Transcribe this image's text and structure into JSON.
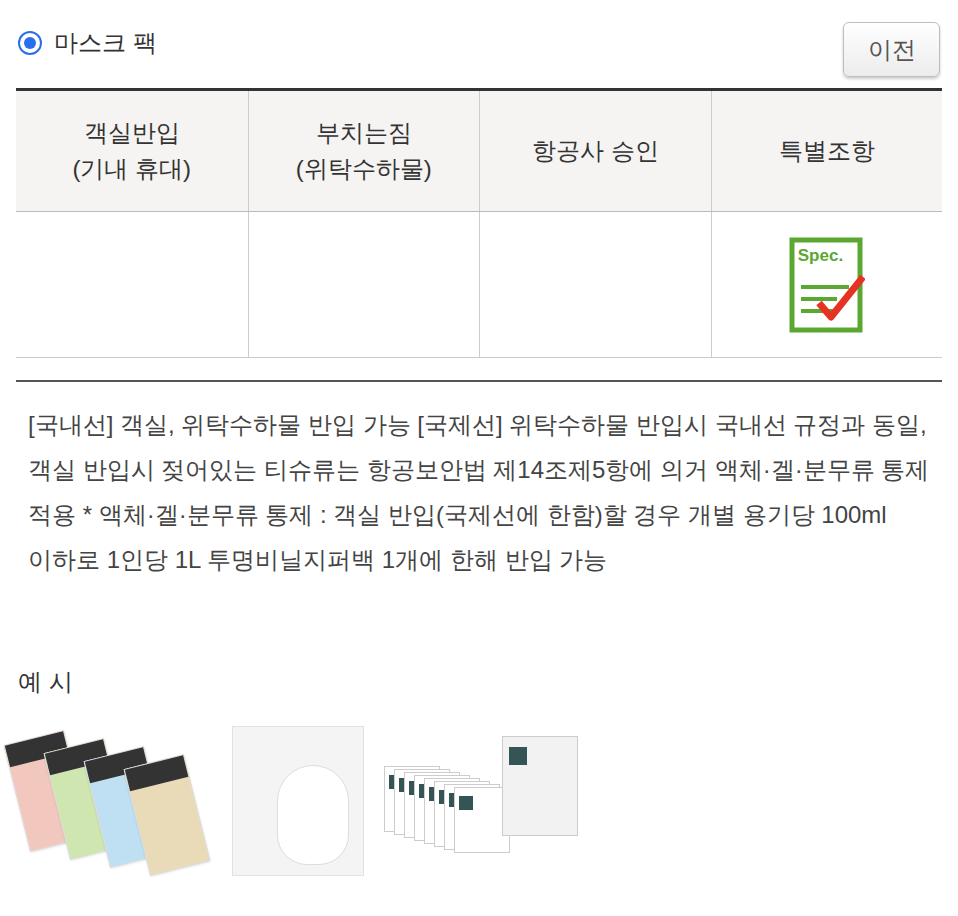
{
  "category": {
    "label": "마스크 팩",
    "selected": true
  },
  "back_button": {
    "label": "이전"
  },
  "table": {
    "columns": [
      {
        "lines": [
          "객실반입",
          "(기내 휴대)"
        ]
      },
      {
        "lines": [
          "부치는짐",
          "(위탁수하물)"
        ]
      },
      {
        "lines": [
          "항공사 승인"
        ]
      },
      {
        "lines": [
          "특별조항"
        ]
      }
    ],
    "rows": [
      {
        "cells": [
          {
            "kind": "empty"
          },
          {
            "kind": "empty"
          },
          {
            "kind": "empty"
          },
          {
            "kind": "spec-icon",
            "text": "Spec."
          }
        ]
      }
    ]
  },
  "description": "[국내선] 객실, 위탁수하물 반입 가능 [국제선] 위탁수하물 반입시 국내선 규정과 동일, 객실 반입시 젖어있는 티슈류는 항공보안법 제14조제5항에 의거 액체·겔·분무류 통제 적용 * 액체·겔·분무류 통제 : 객실 반입(국제선에 한함)할 경우 개별 용기당 100ml 이하로 1인당 1L 투명비닐지퍼백 1개에 한해 반입 가능",
  "examples": {
    "title": "예 시",
    "images": [
      {
        "kind": "sachets"
      },
      {
        "kind": "sheet"
      },
      {
        "kind": "box"
      }
    ]
  }
}
